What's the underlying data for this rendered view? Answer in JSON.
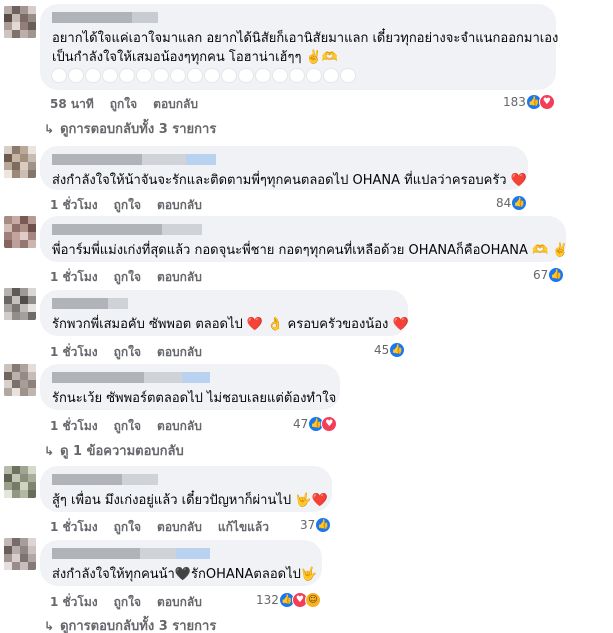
{
  "colors": {
    "bubble": "#f0f2f5",
    "meta_text": "#65676b",
    "like_blue": "#1877f2",
    "love_red": "#f33e58"
  },
  "comments": [
    {
      "text_lines": [
        "อยากได้ใจแค่เอาใจมาแลก อยากได้นิสัยก็เอานิสัยมาแลก เดี๋ยวทุกอย่างจะจำแนกออกมาเอง",
        "เป็นกำลังใจให้เสมอน้องๆทุกคน โอฮาน่าเฮ้ๆๆ ✌️🫶"
      ],
      "time": "58 นาที",
      "like_label": "ถูกใจ",
      "reply_label": "ตอบกลับ",
      "reaction_count": "183",
      "reactions": [
        "like-icon",
        "love-icon"
      ]
    },
    {
      "text_lines": [
        "ส่งกำลังใจให้น้าจันจะรักและติดตามพี่ๆทุกคนตลอดไป OHANA ที่แปลว่าครอบครัว ❤️"
      ],
      "time": "1 ชั่วโมง",
      "like_label": "ถูกใจ",
      "reply_label": "ตอบกลับ",
      "reaction_count": "84",
      "reactions": [
        "like-icon"
      ]
    },
    {
      "text_lines": [
        "พี่อาร์มพี่แม่งเก่งที่สุดแล้ว กอดจุนะพี่ชาย กอดๆทุกคนที่เหลือด้วย OHANAก็คือOHANA 🫶 ✌️"
      ],
      "time": "1 ชั่วโมง",
      "like_label": "ถูกใจ",
      "reply_label": "ตอบกลับ",
      "reaction_count": "67",
      "reactions": [
        "like-icon"
      ]
    },
    {
      "text_lines": [
        "รักพวกพี่เสมอคับ ซัพพอต ตลอดไป ❤️ 👌 ครอบครัวของน้อง ❤️"
      ],
      "time": "1 ชั่วโมง",
      "like_label": "ถูกใจ",
      "reply_label": "ตอบกลับ",
      "reaction_count": "45",
      "reactions": [
        "like-icon"
      ]
    },
    {
      "text_lines": [
        "รักนะเว้ย ซัพพอร์ตตลอดไป ไม่ชอบเลยแต่ต้องทำใจ"
      ],
      "time": "1 ชั่วโมง",
      "like_label": "ถูกใจ",
      "reply_label": "ตอบกลับ",
      "reaction_count": "47",
      "reactions": [
        "like-icon",
        "love-icon"
      ]
    },
    {
      "text_lines": [
        "สู้ๆ เพื่อน มึงเก่งอยู่แล้ว เดี๋ยวปัญหาก็ผ่านไป 🤟❤️"
      ],
      "time": "1 ชั่วโมง",
      "like_label": "ถูกใจ",
      "reply_label": "ตอบกลับ",
      "edited_label": "แก้ไขแล้ว",
      "reaction_count": "37",
      "reactions": [
        "like-icon"
      ]
    },
    {
      "text_lines": [
        "ส่งกำลังใจให้ทุกคนน้า🖤รักOHANAตลอดไป🤟"
      ],
      "time": "1 ชั่วโมง",
      "like_label": "ถูกใจ",
      "reply_label": "ตอบกลับ",
      "reaction_count": "132",
      "reactions": [
        "like-icon",
        "love-icon",
        "haha-icon"
      ]
    }
  ],
  "view_replies": [
    "ดูการตอบกลับทั้ง 3 รายการ",
    "ดู 1 ข้อความตอบกลับ",
    "ดูการตอบกลับทั้ง 3 รายการ"
  ]
}
